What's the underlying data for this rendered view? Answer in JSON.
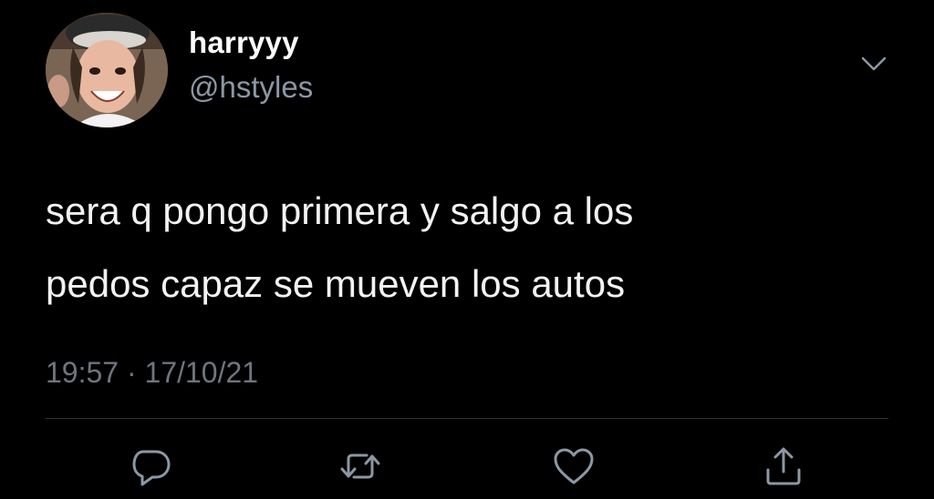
{
  "tweet": {
    "display_name": "harryyy",
    "handle": "@hstyles",
    "text_lines": [
      "sera q pongo primera y salgo a los",
      "pedos capaz se mueven los autos"
    ],
    "timestamp": "19:57 · 17/10/21"
  },
  "icons": {
    "more": "chevron-down-icon",
    "reply": "reply-icon",
    "retweet": "retweet-icon",
    "like": "heart-icon",
    "share": "share-icon"
  },
  "colors": {
    "background": "#000000",
    "text": "#ffffff",
    "secondary_text": "#8b98a5",
    "icon": "#8b98a5",
    "divider": "#2f3336"
  }
}
